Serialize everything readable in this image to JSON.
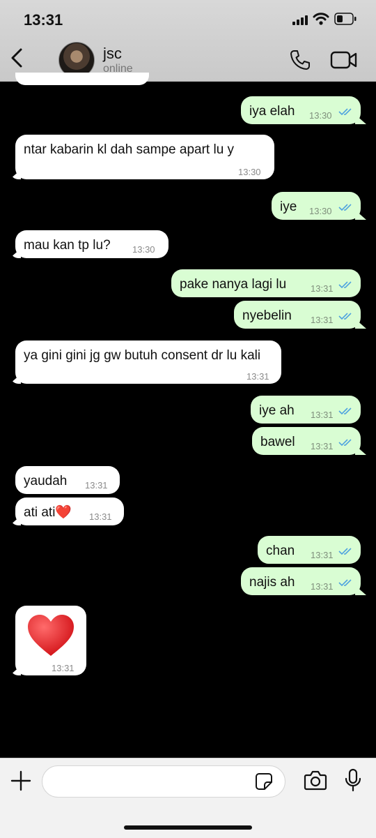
{
  "status_bar": {
    "time": "13:31"
  },
  "header": {
    "name": "jsc",
    "status": "online"
  },
  "messages": [
    {
      "text": "",
      "time": ""
    },
    {
      "text": "iya elah",
      "time": "13:30"
    },
    {
      "text": "ntar kabarin kl dah sampe apart lu y",
      "time": "13:30"
    },
    {
      "text": "iye",
      "time": "13:30"
    },
    {
      "text": "mau kan tp lu?",
      "time": "13:30"
    },
    {
      "text": "pake nanya lagi lu",
      "time": "13:31"
    },
    {
      "text": "nyebelin",
      "time": "13:31"
    },
    {
      "text": "ya gini gini jg gw butuh consent dr lu kali",
      "time": "13:31"
    },
    {
      "text": "iye ah",
      "time": "13:31"
    },
    {
      "text": "bawel",
      "time": "13:31"
    },
    {
      "text": "yaudah",
      "time": "13:31"
    },
    {
      "text": "ati ati❤️",
      "time": "13:31"
    },
    {
      "text": "chan",
      "time": "13:31"
    },
    {
      "text": "najis ah",
      "time": "13:31"
    },
    {
      "text": "❤️",
      "time": "13:31"
    }
  ],
  "input": {
    "placeholder": ""
  },
  "icons": {
    "back": "chevron-left-icon",
    "call": "phone-icon",
    "video": "video-camera-icon",
    "add": "plus-icon",
    "sticker": "sticker-icon",
    "camera": "camera-icon",
    "mic": "microphone-icon",
    "read": "double-check-icon"
  },
  "colors": {
    "incoming": "#ffffff",
    "outgoing": "#d9fdd3",
    "read_ticks": "#4fa3e0",
    "background": "#000000"
  }
}
